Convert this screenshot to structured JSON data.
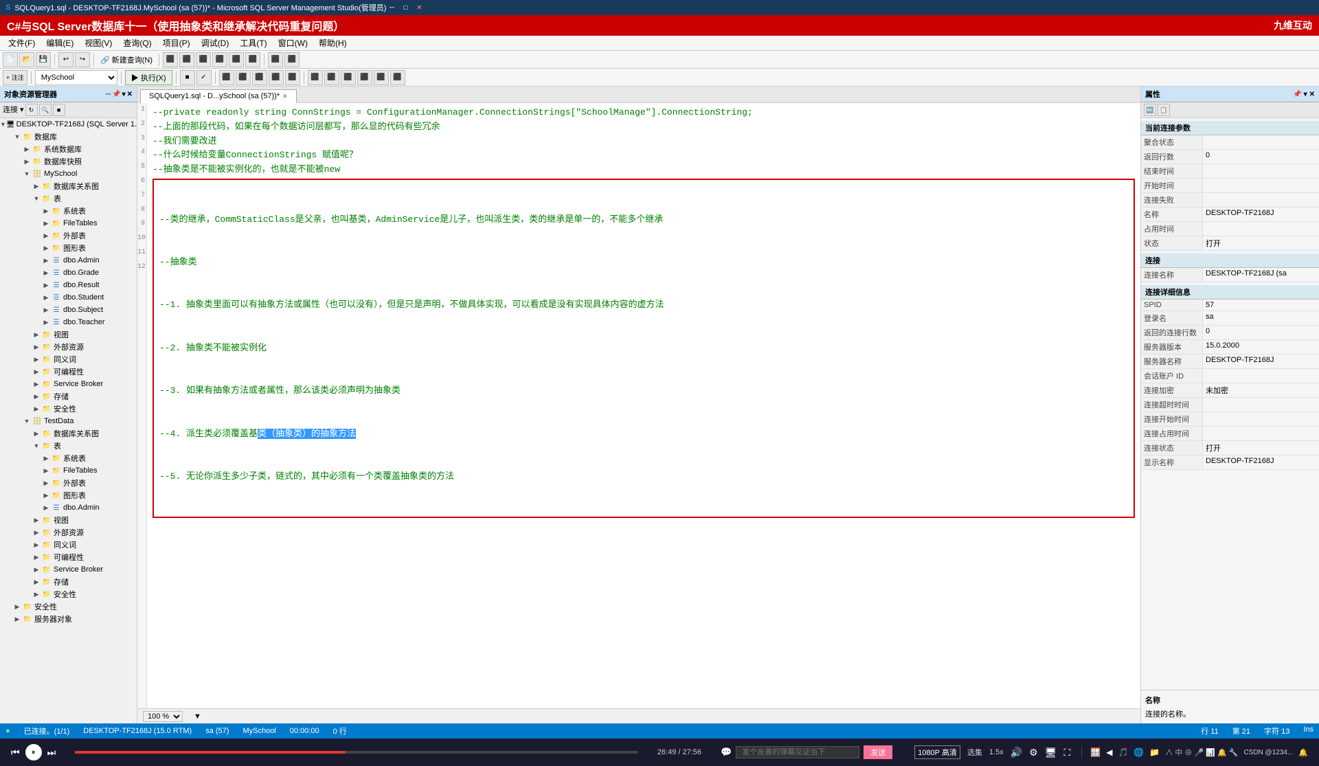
{
  "titlebar": {
    "title": "SQLQuery1.sql - DESKTOP-TF2168J.MySchool (sa (57))* - Microsoft SQL Server Management Studio(管理员)",
    "controls": [
      "─",
      "□",
      "✕"
    ]
  },
  "banner": {
    "text": "C#与SQL Server数据库十一（使用抽象类和继承解决代码重复问题）",
    "brand": "九维互动"
  },
  "menubar": {
    "items": [
      "文件(F)",
      "编辑(E)",
      "视图(V)",
      "查询(Q)",
      "项目(P)",
      "调试(D)",
      "工具(T)",
      "窗口(W)",
      "帮助(H)"
    ]
  },
  "toolbar1": {
    "db_label": "MySchool",
    "exec_label": "▶ 执行(X)",
    "buttons": [
      "新建查询(N)",
      "■",
      "√",
      "■",
      "■",
      "■",
      "■",
      "■",
      "■",
      "■",
      "■"
    ]
  },
  "tabs": [
    {
      "label": "SQLQuery1.sql - D...ySchool (sa (57))*",
      "active": true
    },
    {
      "label": "×",
      "active": false
    }
  ],
  "object_explorer": {
    "header": "对象资源管理器",
    "server": "DESKTOP-TF2168J (SQL Server 1...",
    "tree": [
      {
        "label": "数据库",
        "level": 1,
        "expanded": true,
        "type": "folder"
      },
      {
        "label": "系统数据库",
        "level": 2,
        "expanded": false,
        "type": "folder"
      },
      {
        "label": "数据库快照",
        "level": 2,
        "expanded": false,
        "type": "folder"
      },
      {
        "label": "MySchool",
        "level": 2,
        "expanded": true,
        "type": "database"
      },
      {
        "label": "数据库关系图",
        "level": 3,
        "expanded": false,
        "type": "folder"
      },
      {
        "label": "表",
        "level": 3,
        "expanded": true,
        "type": "folder"
      },
      {
        "label": "系统表",
        "level": 4,
        "expanded": false,
        "type": "folder"
      },
      {
        "label": "FileTables",
        "level": 4,
        "expanded": false,
        "type": "folder"
      },
      {
        "label": "外部表",
        "level": 4,
        "expanded": false,
        "type": "folder"
      },
      {
        "label": "图形表",
        "level": 4,
        "expanded": false,
        "type": "folder"
      },
      {
        "label": "dbo.Admin",
        "level": 4,
        "expanded": false,
        "type": "table"
      },
      {
        "label": "dbo.Grade",
        "level": 4,
        "expanded": false,
        "type": "table"
      },
      {
        "label": "dbo.Result",
        "level": 4,
        "expanded": false,
        "type": "table"
      },
      {
        "label": "dbo.Student",
        "level": 4,
        "expanded": false,
        "type": "table"
      },
      {
        "label": "dbo.Subject",
        "level": 4,
        "expanded": false,
        "type": "table"
      },
      {
        "label": "dbo.Teacher",
        "level": 4,
        "expanded": false,
        "type": "table"
      },
      {
        "label": "视图",
        "level": 3,
        "expanded": false,
        "type": "folder"
      },
      {
        "label": "外部资源",
        "level": 3,
        "expanded": false,
        "type": "folder"
      },
      {
        "label": "同义词",
        "level": 3,
        "expanded": false,
        "type": "folder"
      },
      {
        "label": "可编程性",
        "level": 3,
        "expanded": false,
        "type": "folder"
      },
      {
        "label": "Service Broker",
        "level": 3,
        "expanded": false,
        "type": "folder"
      },
      {
        "label": "存储",
        "level": 3,
        "expanded": false,
        "type": "folder"
      },
      {
        "label": "安全性",
        "level": 3,
        "expanded": false,
        "type": "folder"
      },
      {
        "label": "TestData",
        "level": 2,
        "expanded": true,
        "type": "database"
      },
      {
        "label": "数据库关系图",
        "level": 3,
        "expanded": false,
        "type": "folder"
      },
      {
        "label": "表",
        "level": 3,
        "expanded": true,
        "type": "folder"
      },
      {
        "label": "系统表",
        "level": 4,
        "expanded": false,
        "type": "folder"
      },
      {
        "label": "FileTables",
        "level": 4,
        "expanded": false,
        "type": "folder"
      },
      {
        "label": "外部表",
        "level": 4,
        "expanded": false,
        "type": "folder"
      },
      {
        "label": "图形表",
        "level": 4,
        "expanded": false,
        "type": "folder"
      },
      {
        "label": "dbo.Admin",
        "level": 4,
        "expanded": false,
        "type": "table"
      },
      {
        "label": "视图",
        "level": 3,
        "expanded": false,
        "type": "folder"
      },
      {
        "label": "外部资源",
        "level": 3,
        "expanded": false,
        "type": "folder"
      },
      {
        "label": "同义词",
        "level": 3,
        "expanded": false,
        "type": "folder"
      },
      {
        "label": "可编程性",
        "level": 3,
        "expanded": false,
        "type": "folder"
      },
      {
        "label": "Service Broker",
        "level": 3,
        "expanded": false,
        "type": "folder"
      },
      {
        "label": "存储",
        "level": 3,
        "expanded": false,
        "type": "folder"
      },
      {
        "label": "安全性",
        "level": 3,
        "expanded": false,
        "type": "folder"
      },
      {
        "label": "安全性",
        "level": 1,
        "expanded": false,
        "type": "folder"
      },
      {
        "label": "服务器对象",
        "level": 1,
        "expanded": false,
        "type": "folder"
      }
    ]
  },
  "editor": {
    "lines": [
      "--private readonly string ConnStrings = ConfigurationManager.ConnectionStrings[\"SchoolManage\"].ConnectionString;",
      "--上面的那段代码，如果在每个数据访问层都写，那么显的代码有些冗余",
      "--我们需要改进",
      "--什么时候给变量ConnectionStrings 赋值呢？",
      "--抽象类是不能被实例化的，也就是不能被new",
      "--类的继承，CommStaticClass是父亲，也叫基类，AdminService是儿子，也叫派生类，类的继承是单一的，不能多个继承",
      "--抽象类",
      "--1. 抽象类里面可以有抽象方法或属性（也可以没有），但是只是声明，不做具体实现，可以看成是没有实现具体内容的虚方法",
      "--2. 抽象类不能被实例化",
      "--3. 如果有抽象方法或者属性，那么该类必须声明为抽象类",
      "--4. 派生类必须覆盖基类（抽象类）的抽象方法",
      "--5. 无论你派生多少子类，链式的，其中必须有一个类覆盖抽象类的方法"
    ],
    "highlighted_line_index": 10,
    "highlighted_text": "类（抽象类）的抽象方法",
    "box_start": 5,
    "box_end": 11,
    "zoom": "100 %"
  },
  "statusbar_bottom": {
    "connection": "已连接。(1/1)",
    "server": "DESKTOP-TF2168J (15.0 RTM)",
    "login": "sa (57)",
    "db": "MySchool",
    "time": "00:00:00",
    "rows": "0 行",
    "line": "行 11",
    "col": "第 21",
    "char": "字符 13",
    "ins": "Ins"
  },
  "properties": {
    "header": "属性",
    "section_connection": "当前连接参数",
    "aggregate_state": "聚合状态",
    "rows_returned": "返回行数",
    "value_rows_returned": "0",
    "cursor_time": "结束时间",
    "open_time": "开始时间",
    "connection_failed": "连接失败",
    "name": "名称",
    "name_value": "DESKTOP-TF2168J",
    "used_time": "占用时间",
    "status": "状态",
    "status_value": "打开",
    "section_conn": "连接",
    "conn_name": "连接名称",
    "conn_name_value": "DESKTOP-TF2168J (sa",
    "section_detail": "连接详细信息",
    "spid": "SPID",
    "spid_value": "57",
    "login": "登录名",
    "login_value": "sa",
    "returned_rows": "返回的连接行数",
    "returned_rows_value": "0",
    "server_ver": "服务器版本",
    "server_ver_value": "15.0.2000",
    "server_name": "服务器名称",
    "server_name_value": "DESKTOP-TF2168J",
    "session_id": "会话账户 ID",
    "conn_encrypt": "连接加密",
    "conn_encrypt_value": "未加密",
    "conn_timeout": "连接超时时间",
    "conn_open_time": "连接开始时间",
    "conn_used_time": "连接占用时间",
    "conn_status": "连接状态",
    "conn_status_value": "打开",
    "display_name": "显示名称",
    "display_name_value": "DESKTOP-TF2168J",
    "footer_title": "名称",
    "footer_desc": "连接的名称。"
  },
  "video_bar": {
    "time_current": "26:49",
    "time_total": "27:56",
    "chat_placeholder": "发个友善的弹幕见证当下",
    "send_label": "发送",
    "quality": "1080P 高清",
    "select_label": "选集",
    "speed": "1.5x",
    "icons": [
      "prev",
      "play-pause",
      "next",
      "danmu",
      "gift",
      "volume",
      "settings",
      "theater",
      "fullscreen"
    ]
  }
}
